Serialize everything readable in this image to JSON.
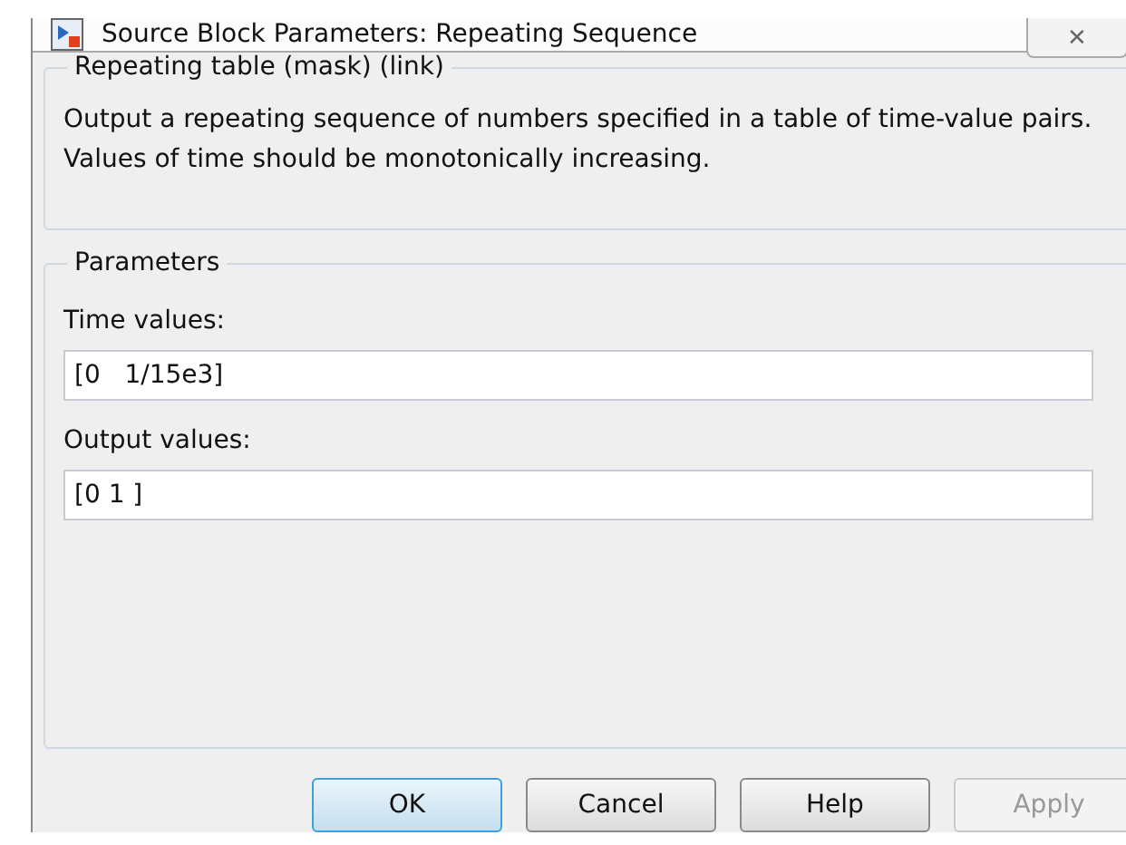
{
  "window": {
    "title": "Source Block Parameters: Repeating Sequence",
    "close_label": "✕"
  },
  "description_group": {
    "title": "Repeating table (mask) (link)",
    "text": "Output a repeating sequence of numbers specified in a table of time-value pairs. Values of time should be monotonically increasing."
  },
  "parameters": {
    "title": "Parameters",
    "fields": [
      {
        "label": "Time values:",
        "value": "[0   1/15e3]"
      },
      {
        "label": "Output values:",
        "value": "[0 1 ]"
      }
    ]
  },
  "buttons": [
    {
      "label": "OK",
      "default": true,
      "disabled": false
    },
    {
      "label": "Cancel",
      "default": false,
      "disabled": false
    },
    {
      "label": "Help",
      "default": false,
      "disabled": false
    },
    {
      "label": "Apply",
      "default": false,
      "disabled": true
    }
  ]
}
